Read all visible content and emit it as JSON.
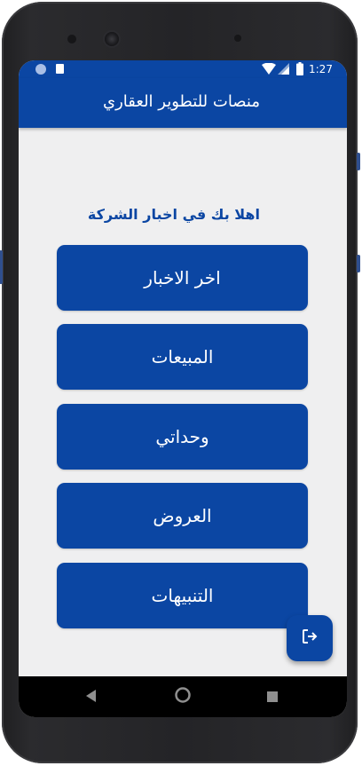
{
  "status": {
    "time": "1:27",
    "icons": [
      "circle-status-icon",
      "sim-card-icon",
      "wifi-icon",
      "signal-icon",
      "battery-icon"
    ]
  },
  "appbar": {
    "title": "منصات للتطوير العقاري"
  },
  "main": {
    "welcome": "اهلا بك في اخبار الشركة",
    "buttons": [
      {
        "label": "اخر الاخبار"
      },
      {
        "label": "المبيعات"
      },
      {
        "label": "وحداتي"
      },
      {
        "label": "العروض"
      },
      {
        "label": "التنبيهات"
      }
    ]
  },
  "fab": {
    "icon": "logout-icon"
  },
  "navigation": {
    "icons": [
      "back-icon",
      "home-icon",
      "recents-icon"
    ]
  },
  "colors": {
    "primary": "#0b46a3",
    "background": "#efeff0",
    "navbar": "#000000"
  }
}
